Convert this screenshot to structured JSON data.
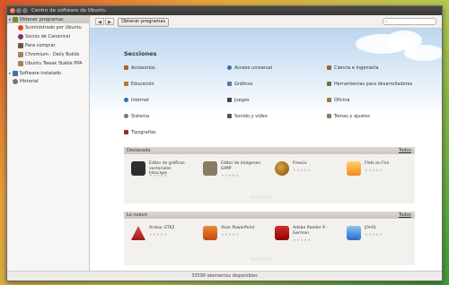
{
  "window": {
    "title": "Centro de software de Ubuntu"
  },
  "sidebar": {
    "items": [
      {
        "label": "Obtener programas",
        "icon": "download-icon"
      },
      {
        "label": "Suministrado por Ubuntu",
        "icon": "ubuntu-icon"
      },
      {
        "label": "Socios de Canonical",
        "icon": "canonical-icon"
      },
      {
        "label": "Para comprar",
        "icon": "cart-icon"
      },
      {
        "label": "Chromium - Daily Builds",
        "icon": "package-icon"
      },
      {
        "label": "Ubuntu Tweak Stable PPA",
        "icon": "package-icon"
      },
      {
        "label": "Software instalado",
        "icon": "computer-icon"
      },
      {
        "label": "Historial",
        "icon": "clock-icon"
      }
    ]
  },
  "toolbar": {
    "back": "◀",
    "forward": "▶",
    "tab_label": "Obtener programas",
    "search_placeholder": ""
  },
  "sections": {
    "title": "Secciones",
    "categories": [
      "Accesorios",
      "Acceso universal",
      "Ciencia e ingeniería",
      "Educación",
      "Gráficos",
      "Herramientas para desarrolladores",
      "Internet",
      "Juegos",
      "Oficina",
      "Sistema",
      "Sonido y vídeo",
      "Temas y ajustes",
      "Tipografías"
    ]
  },
  "featured": {
    "title": "Destacado",
    "all_label": "Todos",
    "apps": [
      {
        "name": "Editor de gráficos vectoriales Inkscape",
        "icon": "inkscape-icon",
        "color": "#333333"
      },
      {
        "name": "Editor de imágenes GIMP",
        "icon": "gimp-icon",
        "color": "#8a7a62"
      },
      {
        "name": "Freeciv",
        "icon": "freeciv-icon",
        "color": "#b8860b"
      },
      {
        "name": "Flets an Fire",
        "icon": "frets-icon",
        "color": "#f0a030"
      }
    ]
  },
  "newest": {
    "title": "Lo nuevo",
    "all_label": "Todos",
    "apps": [
      {
        "name": "Ardour GTK2",
        "icon": "ardour-icon",
        "color": "#c62828"
      },
      {
        "name": "Visor PowerPoint",
        "icon": "powerpoint-icon",
        "color": "#d84315"
      },
      {
        "name": "Adobe Reader 9 - German",
        "icon": "adobe-reader-icon",
        "color": "#b71c1c"
      },
      {
        "name": "JOrAS",
        "icon": "joras-icon",
        "color": "#3a7bd5"
      }
    ]
  },
  "stars": "★★★★★",
  "pager": "○○○○○",
  "status": "33590 elementos disponibles"
}
